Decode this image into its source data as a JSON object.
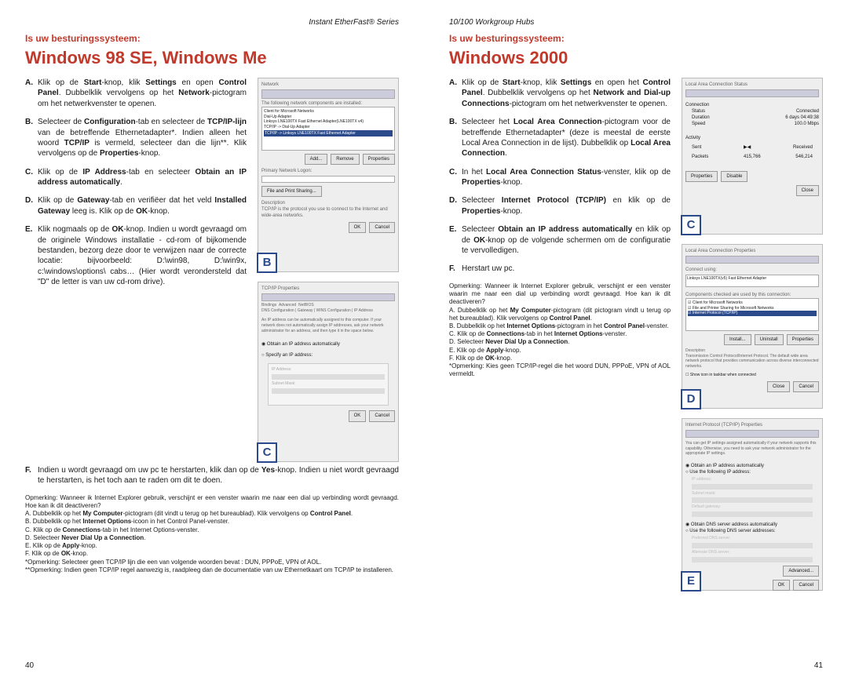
{
  "left": {
    "running": "Instant EtherFast® Series",
    "intro": "Is uw besturingssysteem:",
    "title": "Windows 98 SE, Windows Me",
    "steps": [
      {
        "l": "A.",
        "t": "Klik op de <b>Start</b>-knop, klik <b>Settings</b> en open <b>Control Panel</b>. Dubbelklik vervolgens op het <b>Network</b>-pictogram om het netwerkvenster te openen."
      },
      {
        "l": "B.",
        "t": "Selecteer de <b>Configuration</b>-tab en selecteer de <b>TCP/IP-lijn</b> van de betreffende Ethernetadapter*. Indien alleen het woord <b>TCP/IP</b> is vermeld, selecteer dan die lijn**. Klik vervolgens op de <b>Properties</b>-knop."
      },
      {
        "l": "C.",
        "t": "Klik op de <b>IP Address</b>-tab en selecteer <b>Obtain an IP address automatically</b>."
      },
      {
        "l": "D.",
        "t": "Klik op de <b>Gateway</b>-tab en verifiëer dat het veld <b>Installed Gateway</b> leeg is. Klik op de <b>OK</b>-knop."
      },
      {
        "l": "E.",
        "t": "Klik nogmaals op de <b>OK</b>-knop. Indien u wordt gevraagd om de originele Windows installatie - cd-rom of bijkomende bestanden, bezorg deze door te verwijzen naar de correcte locatie: bijvoorbeeld: D:\\win98, D:\\win9x, c:\\windows\\options\\ cabs… (Hier wordt verondersteld dat \"D\" de letter is van uw cd-rom drive)."
      },
      {
        "l": "F.",
        "t": "Indien u wordt gevraagd om uw pc te herstarten, klik dan op de <b>Yes</b>-knop. Indien u niet wordt gevraagd te herstarten, is het toch aan te raden om dit te doen."
      }
    ],
    "remark": "Opmerking: Wanneer ik Internet Explorer gebruik, verschijnt er een venster waarin me naar een dial up verbinding wordt gevraagd. Hoe kan ik dit deactiveren?<br>A. Dubbelklik op het <b>My Computer</b>-pictogram (dit vindt u terug op het bureaublad). Klik vervolgens op <b>Control Panel</b>.<br>B. Dubbelklik op het <b>Internet Options</b>-icoon in het Control Panel-venster.<br>C. Klik op de <b>Connections</b>-tab in het Internet Options-venster.<br>D. Selecteer <b>Never Dial Up a Connection</b>.<br>E. Klik op de <b>Apply</b>-knop.<br>F. Klik op de <b>OK</b>-knop.<br>*Opmerking: Selecteer geen TCP/IP lijn die een van volgende woorden bevat : DUN, PPPoE, VPN of AOL.<br>**Opmerking: Indien geen TCP/IP regel aanwezig is, raadpleeg dan de documentatie van uw Ethernetkaart om TCP/IP te installeren.",
    "figB": "B",
    "figC": "C",
    "folio": "40"
  },
  "right": {
    "running": "10/100 Workgroup Hubs",
    "intro": "Is uw besturingssysteem:",
    "title": "Windows 2000",
    "steps": [
      {
        "l": "A.",
        "t": "Klik op de <b>Start</b>-knop, klik <b>Settings</b> en open het <b>Control Panel</b>. Dubbelklik vervolgens op het <b>Network and Dial-up Connections</b>-pictogram om het netwerkvenster te openen."
      },
      {
        "l": "B.",
        "t": "Selecteer het <b>Local Area Connection</b>-pictogram voor de betreffende Ethernetadapter* (deze is meestal de eerste Local Area Connection in de lijst). Dubbelklik op <b>Local Area Connection</b>."
      },
      {
        "l": "C.",
        "t": "In het <b>Local Area Connection Status</b>-venster, klik op de <b>Properties</b>-knop."
      },
      {
        "l": "D.",
        "t": "Selecteer <b>Internet Protocol (TCP/IP)</b> en klik op de <b>Properties</b>-knop."
      },
      {
        "l": "E.",
        "t": "Selecteer <b>Obtain an IP address automatically</b> en klik op de <b>OK</b>-knop op de volgende schermen om de configuratie te vervolledigen."
      },
      {
        "l": "F.",
        "t": "Herstart uw pc."
      }
    ],
    "remark": "Opmerking: Wanneer ik Internet Explorer gebruik, verschijnt er een venster waarin me naar een dial up verbinding wordt gevraagd. Hoe kan ik dit deactiveren?<br>A. Dubbelklik op het <b>My Computer</b>-pictogram (dit pictogram vindt u terug op het bureaublad). Klik vervolgens op <b>Control Panel</b>.<br>B. Dubbelklik op het <b>Internet Options</b>-pictogram in het <b>Control Panel</b>-venster.<br>C. Klik op de <b>Connections</b>-tab in het <b>Internet Options</b>-venster.<br>D. Selecteer <b>Never Dial Up a Connection</b>.<br>E. Klik op de <b>Apply</b>-knop.<br>F. Klik op de <b>OK</b>-knop.<br>*Opmerking: Kies geen TCP/IP-regel die het woord DUN, PPPoE, VPN of AOL vermeldt.",
    "figC": "C",
    "figD": "D",
    "figE": "E",
    "folio": "41",
    "lac": {
      "title": "Local Area Connection Status",
      "s": "Status",
      "c": "Connected",
      "d": "Duration",
      "dv": "6 days 04:49:38",
      "sp": "Speed",
      "spv": "100.0 Mbps",
      "act": "Activity",
      "sent": "Sent",
      "recv": "Received",
      "pk": "Packets",
      "pv1": "415,766",
      "pv2": "546,214",
      "prop": "Properties",
      "dis": "Disable",
      "close": "Close"
    }
  }
}
